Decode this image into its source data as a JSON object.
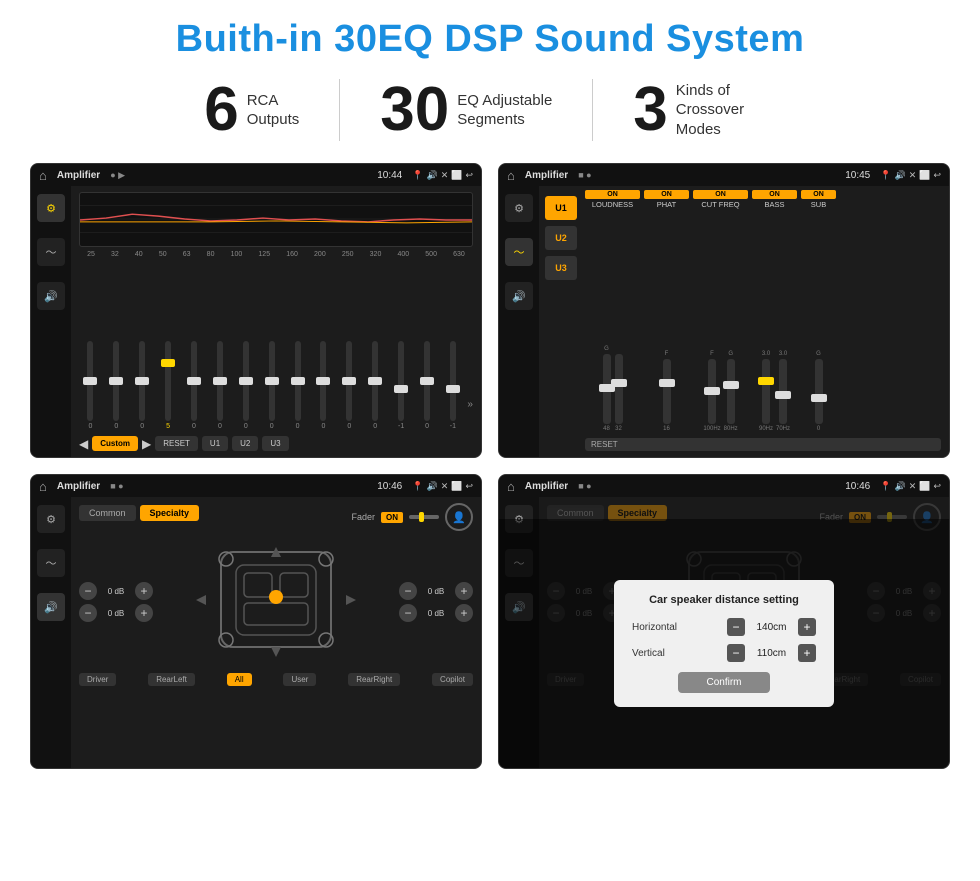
{
  "title": "Buith-in 30EQ DSP Sound System",
  "stats": [
    {
      "number": "6",
      "label": "RCA\nOutputs"
    },
    {
      "number": "30",
      "label": "EQ Adjustable\nSegments"
    },
    {
      "number": "3",
      "label": "Kinds of\nCrossover Modes"
    }
  ],
  "screens": [
    {
      "id": "screen1",
      "appName": "Amplifier",
      "time": "10:44",
      "type": "eq",
      "freqs": [
        "25",
        "32",
        "40",
        "50",
        "63",
        "80",
        "100",
        "125",
        "160",
        "200",
        "250",
        "320",
        "400",
        "500",
        "630"
      ],
      "vals": [
        "0",
        "0",
        "0",
        "5",
        "0",
        "0",
        "0",
        "0",
        "0",
        "0",
        "0",
        "0",
        "-1",
        "0",
        "-1"
      ],
      "bottomBtns": [
        "Custom",
        "RESET",
        "U1",
        "U2",
        "U3"
      ]
    },
    {
      "id": "screen2",
      "appName": "Amplifier",
      "time": "10:45",
      "type": "crossover",
      "uBtns": [
        "U1",
        "U2",
        "U3"
      ],
      "controls": [
        "LOUDNESS",
        "PHAT",
        "CUT FREQ",
        "BASS",
        "SUB"
      ],
      "resetLabel": "RESET"
    },
    {
      "id": "screen3",
      "appName": "Amplifier",
      "time": "10:46",
      "type": "fader",
      "tabs": [
        "Common",
        "Specialty"
      ],
      "faderLabel": "Fader",
      "onLabel": "ON",
      "volLabels": [
        "0 dB",
        "0 dB",
        "0 dB",
        "0 dB"
      ],
      "footerBtns": [
        "Driver",
        "RearLeft",
        "All",
        "User",
        "RearRight",
        "Copilot"
      ],
      "allActive": "All"
    },
    {
      "id": "screen4",
      "appName": "Amplifier",
      "time": "10:46",
      "type": "fader-dialog",
      "tabs": [
        "Common",
        "Specialty"
      ],
      "faderLabel": "Fader",
      "onLabel": "ON",
      "dialog": {
        "title": "Car speaker distance setting",
        "horizontal": {
          "label": "Horizontal",
          "value": "140cm"
        },
        "vertical": {
          "label": "Vertical",
          "value": "110cm"
        },
        "confirmLabel": "Confirm"
      },
      "footerBtns": [
        "Driver",
        "RearLeft",
        "All",
        "User",
        "RearRight",
        "Copilot"
      ]
    }
  ],
  "icons": {
    "home": "⌂",
    "back": "↩",
    "location": "📍",
    "camera": "📷",
    "volume": "🔊",
    "close": "✕",
    "minus_sign": "−",
    "plus_sign": "+"
  }
}
